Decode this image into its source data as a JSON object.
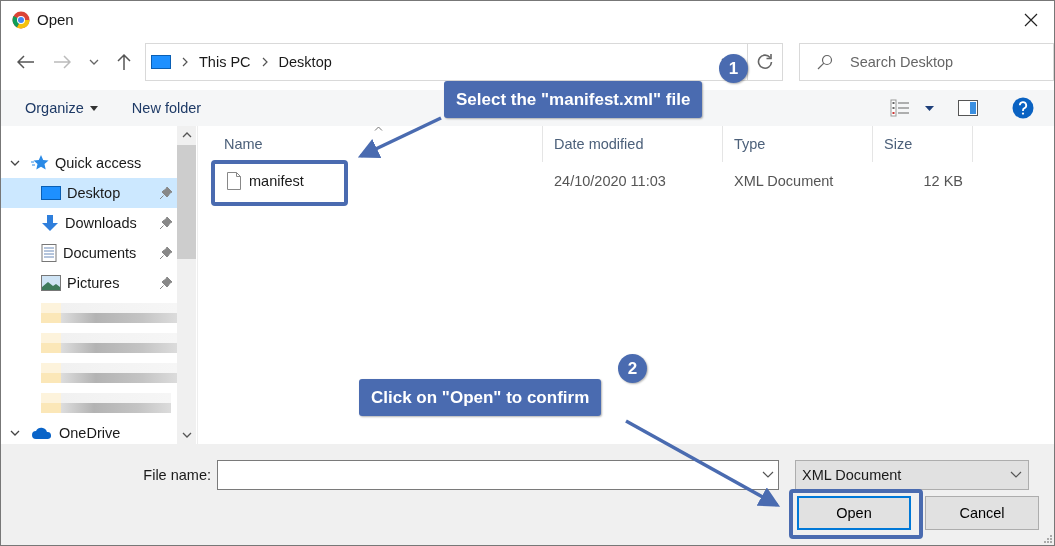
{
  "window": {
    "title": "Open"
  },
  "nav": {
    "breadcrumb": [
      "This PC",
      "Desktop"
    ],
    "search": {
      "placeholder": "Search Desktop"
    }
  },
  "toolbar": {
    "organize": "Organize",
    "new_folder": "New folder"
  },
  "sidebar": {
    "items": [
      {
        "kind": "group",
        "label": "Quick access",
        "expanded": true,
        "selected": false
      },
      {
        "kind": "item",
        "label": "Desktop",
        "selected": true,
        "pinned": true
      },
      {
        "kind": "item",
        "label": "Downloads",
        "selected": false,
        "pinned": true
      },
      {
        "kind": "item",
        "label": "Documents",
        "selected": false,
        "pinned": true
      },
      {
        "kind": "item",
        "label": "Pictures",
        "selected": false,
        "pinned": true
      },
      {
        "kind": "redacted"
      },
      {
        "kind": "redacted"
      },
      {
        "kind": "redacted"
      },
      {
        "kind": "redacted"
      },
      {
        "kind": "group",
        "label": "OneDrive",
        "expanded": true,
        "selected": false
      }
    ]
  },
  "files": {
    "columns": [
      "Name",
      "Date modified",
      "Type",
      "Size"
    ],
    "rows": [
      {
        "name": "manifest",
        "date": "24/10/2020 11:03",
        "type": "XML Document",
        "size": "12 KB"
      }
    ]
  },
  "footer": {
    "file_name_label": "File name:",
    "file_type": "XML Document",
    "buttons": [
      {
        "label": "Open",
        "default": true
      },
      {
        "label": "Cancel",
        "default": false
      }
    ]
  },
  "annotations": [
    {
      "number": "1",
      "text": "Select the \"manifest.xml\" file"
    },
    {
      "number": "2",
      "text": "Click on \"Open\" to confirm"
    }
  ]
}
